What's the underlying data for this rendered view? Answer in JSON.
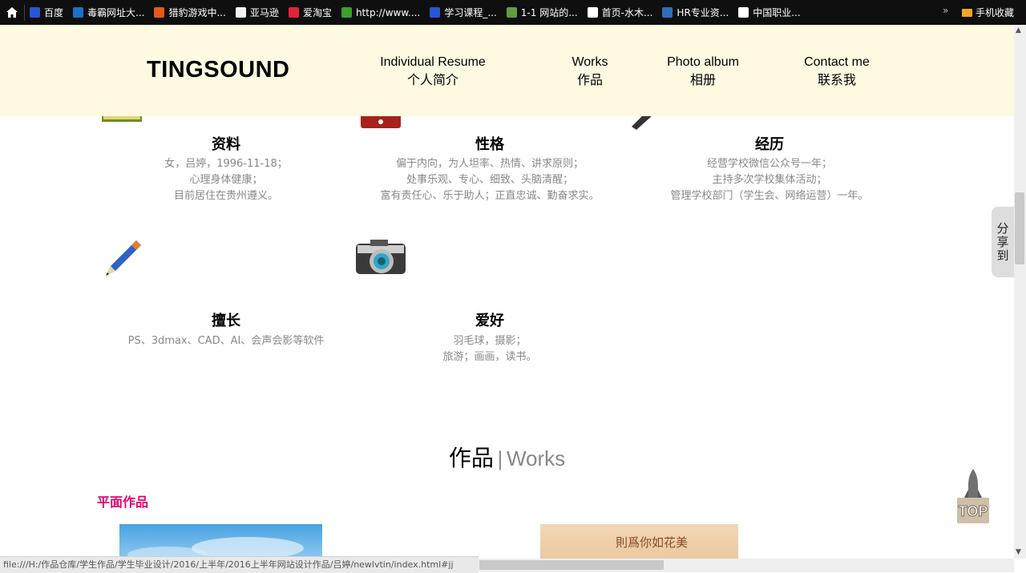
{
  "bookmarks": [
    {
      "label": "百度",
      "icon": "paw-icon",
      "color": "#2b55d8"
    },
    {
      "label": "毒霸网址大...",
      "icon": "k-icon",
      "color": "#1a72c9"
    },
    {
      "label": "猎豹游戏中...",
      "icon": "game-icon",
      "color": "#e25b1a"
    },
    {
      "label": "亚马逊",
      "icon": "amazon-icon",
      "color": "#f4f4f4"
    },
    {
      "label": "爱淘宝",
      "icon": "taobao-icon",
      "color": "#e2233b"
    },
    {
      "label": "http://www....",
      "icon": "grid-icon",
      "color": "#3aa02c"
    },
    {
      "label": "学习课程_...",
      "icon": "paw-icon",
      "color": "#2b55d8"
    },
    {
      "label": "1-1 网站的...",
      "icon": "leaf-icon",
      "color": "#5f9f3d"
    },
    {
      "label": "首页-水木...",
      "icon": "page-icon",
      "color": "#ffffff"
    },
    {
      "label": "HR专业资...",
      "icon": "bird-icon",
      "color": "#2d6fb8"
    },
    {
      "label": "中国职业...",
      "icon": "page-icon",
      "color": "#ffffff"
    }
  ],
  "bookmarks_more": "»",
  "mobile_bookmarks": "手机收藏",
  "nav": {
    "logo": "TINGSOUND",
    "items": [
      {
        "en": "Individual Resume",
        "cn": "个人简介"
      },
      {
        "en": "Works",
        "cn": "作品"
      },
      {
        "en": "Photo album",
        "cn": "相册"
      },
      {
        "en": "Contact me",
        "cn": "联系我"
      }
    ]
  },
  "profile": {
    "blocks": [
      {
        "title": "资料",
        "lines": [
          "女，吕婷，1996-11-18；",
          "心理身体健康；",
          "目前居住在贵州遵义。"
        ]
      },
      {
        "title": "性格",
        "lines": [
          "偏于内向，为人坦率、热情、讲求原则；",
          "处事乐观、专心、细致、头脑清醒；",
          "富有责任心、乐于助人；正直忠诚、勤奋求实。"
        ]
      },
      {
        "title": "经历",
        "lines": [
          "经营学校微信公众号一年；",
          "主持多次学校集体活动；",
          "管理学校部门（学生会、网络运营）一年。"
        ]
      },
      {
        "title": "擅长",
        "lines": [
          "PS、3dmax、CAD、AI、会声会影等软件"
        ]
      },
      {
        "title": "爱好",
        "lines": [
          "羽毛球，摄影；",
          "旅游；画画，读书。"
        ]
      }
    ]
  },
  "works": {
    "title_cn": "作品",
    "separator": "|",
    "title_en": "Works",
    "category": "平面作品",
    "thumb2_text": "則爲你如花美"
  },
  "share_label": "分享到",
  "top_label": "TOP",
  "status_url": "file:///H:/作品仓库/学生作品/学生毕业设计/2016/上半年/2016上半年网站设计作品/吕婷/newlvtin/index.html#jj"
}
